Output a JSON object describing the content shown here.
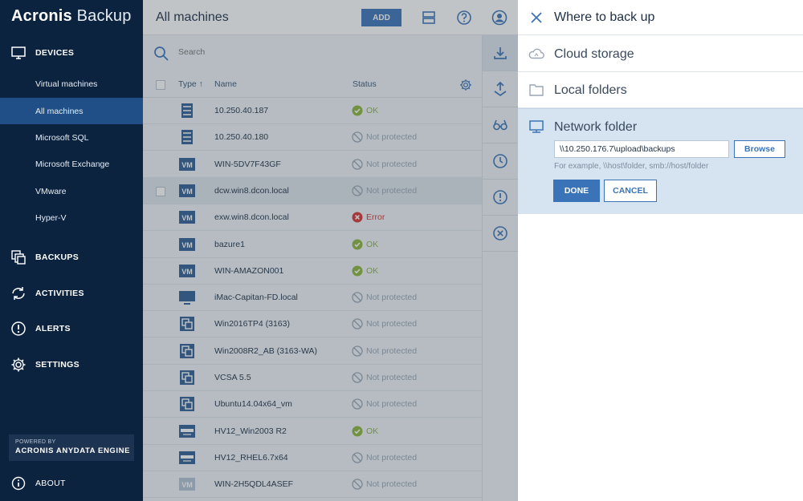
{
  "app": {
    "brand_bold": "Acronis",
    "brand_light": " Backup"
  },
  "sidebar": {
    "sections": [
      {
        "id": "devices",
        "label": "DEVICES",
        "icon": "monitor-icon"
      },
      {
        "id": "backups",
        "label": "BACKUPS",
        "icon": "backups-icon"
      },
      {
        "id": "activities",
        "label": "ACTIVITIES",
        "icon": "activities-icon"
      },
      {
        "id": "alerts",
        "label": "ALERTS",
        "icon": "alert-icon"
      },
      {
        "id": "settings",
        "label": "SETTINGS",
        "icon": "gear-icon"
      },
      {
        "id": "about",
        "label": "ABOUT",
        "icon": "info-icon"
      }
    ],
    "devices_items": [
      {
        "label": "Virtual machines"
      },
      {
        "label": "All machines",
        "active": true
      },
      {
        "label": "Microsoft SQL"
      },
      {
        "label": "Microsoft Exchange"
      },
      {
        "label": "VMware"
      },
      {
        "label": "Hyper-V"
      }
    ],
    "powered_by": "POWERED BY",
    "engine": "ACRONIS ANYDATA ENGINE"
  },
  "main": {
    "title": "All machines",
    "add_label": "ADD",
    "search_placeholder": "Search",
    "columns": {
      "type": "Type ↑",
      "name": "Name",
      "status": "Status"
    },
    "rows": [
      {
        "type": "server",
        "name": "10.250.40.187",
        "status": "OK",
        "status_kind": "ok"
      },
      {
        "type": "server",
        "name": "10.250.40.180",
        "status": "Not protected",
        "status_kind": "none"
      },
      {
        "type": "vm",
        "name": "WIN-5DV7F43GF",
        "status": "Not protected",
        "status_kind": "none"
      },
      {
        "type": "vm",
        "name": "dcw.win8.dcon.local",
        "status": "Not protected",
        "status_kind": "none",
        "selected": true
      },
      {
        "type": "vm",
        "name": "exw.win8.dcon.local",
        "status": "Error",
        "status_kind": "error"
      },
      {
        "type": "vm",
        "name": "bazure1",
        "status": "OK",
        "status_kind": "ok"
      },
      {
        "type": "vm",
        "name": "WIN-AMAZON001",
        "status": "OK",
        "status_kind": "ok"
      },
      {
        "type": "mac",
        "name": "iMac-Capitan-FD.local",
        "status": "Not protected",
        "status_kind": "none"
      },
      {
        "type": "vmware",
        "name": "Win2016TP4 (3163)",
        "status": "Not protected",
        "status_kind": "none"
      },
      {
        "type": "vmware",
        "name": "Win2008R2_AB (3163-WA)",
        "status": "Not protected",
        "status_kind": "none"
      },
      {
        "type": "vmware",
        "name": "VCSA 5.5",
        "status": "Not protected",
        "status_kind": "none"
      },
      {
        "type": "vmware",
        "name": "Ubuntu14.04x64_vm",
        "status": "Not protected",
        "status_kind": "none"
      },
      {
        "type": "hyperv",
        "name": "HV12_Win2003 R2",
        "status": "OK",
        "status_kind": "ok"
      },
      {
        "type": "hyperv",
        "name": "HV12_RHEL6.7x64",
        "status": "Not protected",
        "status_kind": "none"
      },
      {
        "type": "vm-faded",
        "name": "WIN-2H5QDL4ASEF",
        "status": "Not protected",
        "status_kind": "none"
      }
    ],
    "actions": [
      "backup-icon",
      "recovery-icon",
      "glasses-icon",
      "clock-icon",
      "alert-icon",
      "delete-icon"
    ]
  },
  "panel": {
    "title": "Where to back up",
    "options": [
      {
        "label": "Cloud storage",
        "icon": "cloud-icon"
      },
      {
        "label": "Local folders",
        "icon": "folder-icon"
      }
    ],
    "network": {
      "label": "Network folder",
      "icon": "network-folder-icon",
      "path_value": "\\\\10.250.176.7\\upload\\backups",
      "browse_label": "Browse",
      "hint": "For example, \\\\host\\folder, smb://host/folder",
      "done_label": "DONE",
      "cancel_label": "CANCEL"
    }
  },
  "colors": {
    "sidebar_bg": "#0c2340",
    "accent": "#3a73b7",
    "ok": "#8db53a",
    "error": "#d9332e",
    "not_protected": "#9aa6b3"
  }
}
